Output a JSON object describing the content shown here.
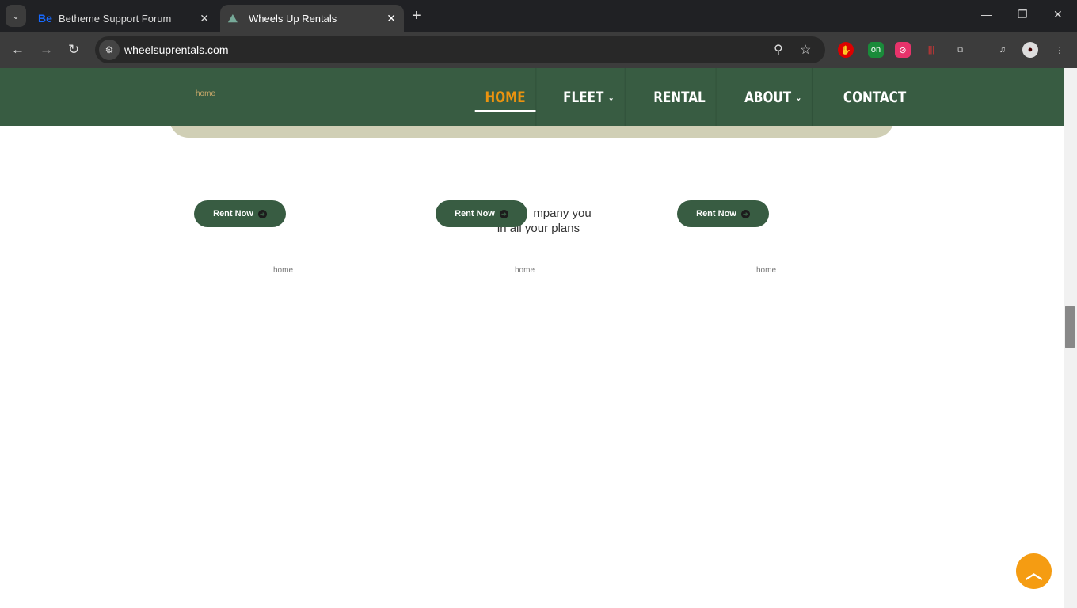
{
  "browser": {
    "tabs": [
      {
        "title": "Betheme Support Forum",
        "icon": "Be"
      },
      {
        "title": "Wheels Up Rentals",
        "icon": "logo"
      }
    ],
    "url": "wheelsuprentals.com"
  },
  "site": {
    "logo_alt": "home",
    "menu": [
      {
        "label": "HOME",
        "active": true
      },
      {
        "label": "FLEET",
        "dropdown": true
      },
      {
        "label": "RENTAL"
      },
      {
        "label": "ABOUT",
        "dropdown": true
      },
      {
        "label": "CONTACT"
      }
    ],
    "rent_label": "Rent Now",
    "tagline_line1": "mpany you",
    "tagline_line2": "in all your plans",
    "image_alt": "home",
    "colors": {
      "header": "#385c42",
      "accent": "#eb930f",
      "banner": "#d0cfb5",
      "back_to_top": "#f59c12"
    }
  }
}
